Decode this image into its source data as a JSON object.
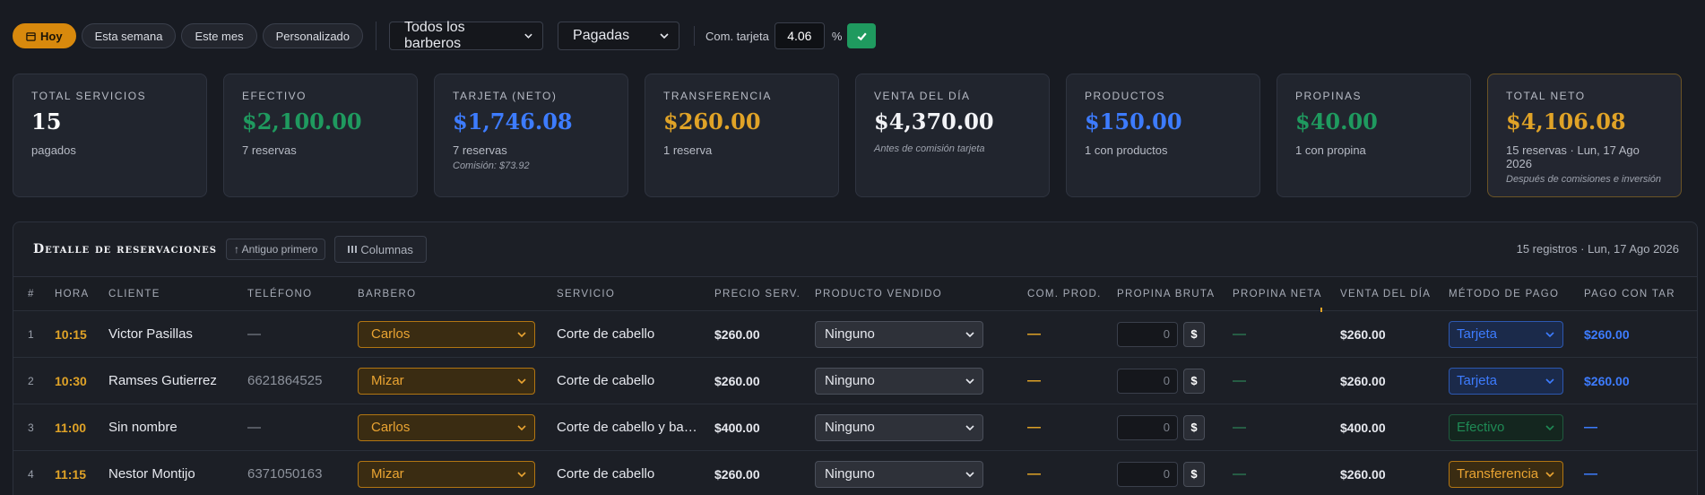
{
  "toolbar": {
    "filters": [
      "Hoy",
      "Esta semana",
      "Este mes",
      "Personalizado"
    ],
    "barber_select": "Todos los barberos",
    "status_select": "Pagadas",
    "commission_label": "Com. tarjeta",
    "commission_value": "4.06",
    "percent": "%"
  },
  "cards": [
    {
      "title": "Total servicios",
      "value": "15",
      "sub": "pagados",
      "note": "",
      "color": "#ffffff"
    },
    {
      "title": "Efectivo",
      "value": "$2,100.00",
      "sub": "7 reservas",
      "note": "",
      "color": "#1f9a5f"
    },
    {
      "title": "Tarjeta (neto)",
      "value": "$1,746.08",
      "sub": "7 reservas",
      "note": "Comisión: $73.92",
      "color": "#3d7cff"
    },
    {
      "title": "Transferencia",
      "value": "$260.00",
      "sub": "1 reserva",
      "note": "",
      "color": "#e0a327"
    },
    {
      "title": "Venta del día",
      "value": "$4,370.00",
      "sub": "",
      "note": "Antes de comisión tarjeta",
      "color": "#f2f3f6"
    },
    {
      "title": "Productos",
      "value": "$150.00",
      "sub": "1 con productos",
      "note": "",
      "color": "#3d7cff"
    },
    {
      "title": "Propinas",
      "value": "$40.00",
      "sub": "1 con propina",
      "note": "",
      "color": "#1f9a5f"
    },
    {
      "title": "Total neto",
      "value": "$4,106.08",
      "sub": "15 reservas · Lun, 17 Ago 2026",
      "note": "Después de comisiones e inversión",
      "color": "#e0a327"
    }
  ],
  "table": {
    "title": "Detalle de reservaciones",
    "sort_label": "↑ Antiguo primero",
    "columns_label": "Columnas",
    "meta": "15 registros · Lun, 17 Ago 2026",
    "headers": [
      "#",
      "Hora",
      "Cliente",
      "Teléfono",
      "Barbero",
      "Servicio",
      "Precio serv.",
      "Producto vendido",
      "Com. prod.",
      "Propina bruta",
      "Propina neta",
      "Venta del día",
      "Método de pago",
      "Pago con tar"
    ],
    "rows": [
      {
        "n": "1",
        "hora": "10:15",
        "cliente": "Victor Pasillas",
        "telefono": "—",
        "barbero": "Carlos",
        "servicio": "Corte de cabello",
        "precio": "$260.00",
        "producto": "Ninguno",
        "com_prod": "—",
        "propina": "0",
        "propina_btn": "$",
        "propina_neta": "—",
        "venta": "$260.00",
        "metodo": "Tarjeta",
        "pago_tarjeta": "$260.00"
      },
      {
        "n": "2",
        "hora": "10:30",
        "cliente": "Ramses Gutierrez",
        "telefono": "6621864525",
        "barbero": "Mizar",
        "servicio": "Corte de cabello",
        "precio": "$260.00",
        "producto": "Ninguno",
        "com_prod": "—",
        "propina": "0",
        "propina_btn": "$",
        "propina_neta": "—",
        "venta": "$260.00",
        "metodo": "Tarjeta",
        "pago_tarjeta": "$260.00"
      },
      {
        "n": "3",
        "hora": "11:00",
        "cliente": "Sin nombre",
        "telefono": "—",
        "barbero": "Carlos",
        "servicio": "Corte de cabello y ba…",
        "precio": "$400.00",
        "producto": "Ninguno",
        "com_prod": "—",
        "propina": "0",
        "propina_btn": "$",
        "propina_neta": "—",
        "venta": "$400.00",
        "metodo": "Efectivo",
        "pago_tarjeta": "—"
      },
      {
        "n": "4",
        "hora": "11:15",
        "cliente": "Nestor Montijo",
        "telefono": "6371050163",
        "barbero": "Mizar",
        "servicio": "Corte de cabello",
        "precio": "$260.00",
        "producto": "Ninguno",
        "com_prod": "—",
        "propina": "0",
        "propina_btn": "$",
        "propina_neta": "—",
        "venta": "$260.00",
        "metodo": "Transferencia",
        "pago_tarjeta": "—"
      }
    ]
  },
  "icons": {
    "calendar": "calendar-icon",
    "check": "check-icon",
    "columns": "columns-icon",
    "chevron": "chevron-down-icon"
  }
}
